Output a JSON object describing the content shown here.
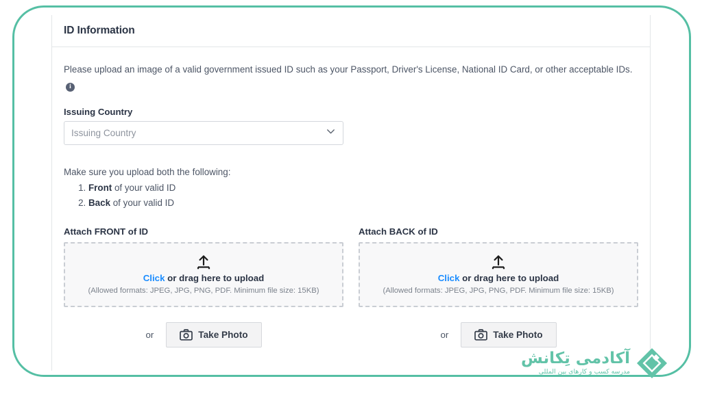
{
  "theme": {
    "frame_color": "#55bfa4",
    "link_color": "#1a8cff",
    "logo_color": "#62c3a8",
    "text_color": "#2b3445",
    "muted_text_color": "#4c5565"
  },
  "card": {
    "title": "ID Information",
    "intro": "Please upload an image of a valid government issued ID such as your Passport, Driver's License, National ID Card, or other acceptable IDs.",
    "info_icon_glyph": "i"
  },
  "issuing_country": {
    "label": "Issuing Country",
    "placeholder": "Issuing Country",
    "value": "",
    "chevron_icon": "chevron-down-icon"
  },
  "requirements": {
    "intro": "Make sure you upload both the following:",
    "items": [
      {
        "strong": "Front",
        "rest": " of your valid ID"
      },
      {
        "strong": "Back",
        "rest": " of your valid ID"
      }
    ]
  },
  "uploads": [
    {
      "label": "Attach FRONT of ID",
      "upload_icon": "upload-icon",
      "click_word": "Click",
      "main_rest": " or drag here to upload",
      "hint": "(Allowed formats: JPEG, JPG, PNG, PDF. Minimum file size: 15KB)",
      "or_text": "or",
      "photo_button": "Take Photo",
      "camera_icon": "camera-icon"
    },
    {
      "label": "Attach BACK of ID",
      "upload_icon": "upload-icon",
      "click_word": "Click",
      "main_rest": " or drag here to upload",
      "hint": "(Allowed formats: JPEG, JPG, PNG, PDF. Minimum file size: 15KB)",
      "or_text": "or",
      "photo_button": "Take Photo",
      "camera_icon": "camera-icon"
    }
  ],
  "logo": {
    "title": "آکادمی تِکانش",
    "subtitle": "مدرسه کسب و کارهای بین المللی",
    "mark_icon": "diamond-logo-icon"
  }
}
